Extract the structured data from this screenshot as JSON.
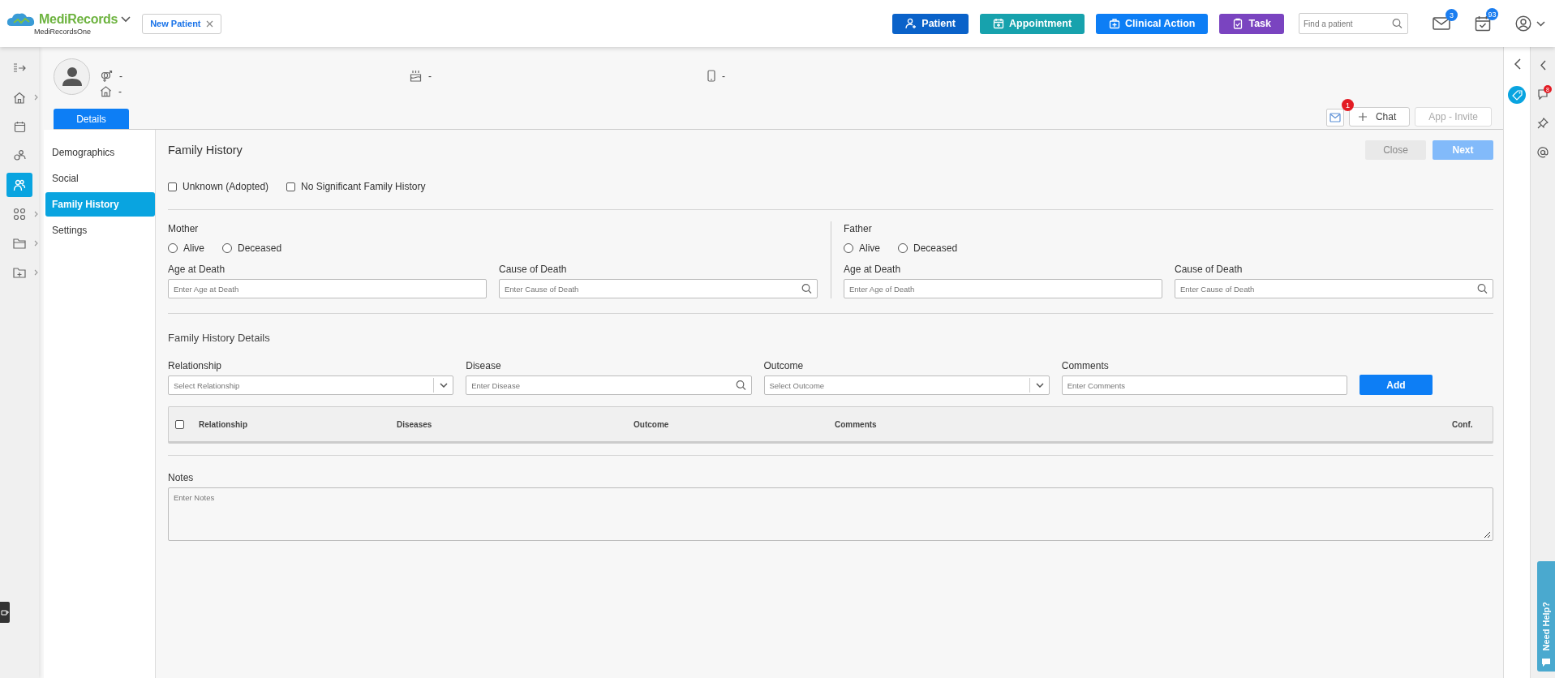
{
  "header": {
    "logo": "MediRecords",
    "logo_sub": "MediRecordsOne",
    "open_tab": {
      "label": "New Patient"
    },
    "actions": [
      {
        "label": "Patient",
        "kind": "patient",
        "color": "#0a62c9"
      },
      {
        "label": "Appointment",
        "kind": "appointment",
        "color": "#17a2ad"
      },
      {
        "label": "Clinical Action",
        "kind": "clinical",
        "color": "#0d7ef5"
      },
      {
        "label": "Task",
        "kind": "task",
        "color": "#7a44c0"
      }
    ],
    "search": {
      "placeholder": "Find a patient"
    },
    "mail_badge": "3",
    "tasks_badge": "93"
  },
  "rail": [
    {
      "kind": "expand",
      "selected": false,
      "submenu": false
    },
    {
      "kind": "home",
      "selected": false,
      "submenu": true
    },
    {
      "kind": "calendar",
      "selected": false,
      "submenu": false
    },
    {
      "kind": "people",
      "selected": false,
      "submenu": false
    },
    {
      "kind": "person",
      "selected": true,
      "submenu": false
    },
    {
      "kind": "apps",
      "selected": false,
      "submenu": true
    },
    {
      "kind": "folder",
      "selected": false,
      "submenu": true
    },
    {
      "kind": "folder-plus",
      "selected": false,
      "submenu": true
    }
  ],
  "patient": {
    "gender": "-",
    "address": "-",
    "birthday": "-",
    "phone": "-"
  },
  "tabs": [
    {
      "label": "Details",
      "selected": true
    }
  ],
  "toolbar": {
    "mail_badge": "1",
    "chat": "Chat",
    "invite": {
      "label": "App - Invite",
      "disabled": true
    }
  },
  "nav": [
    {
      "label": "Demographics",
      "selected": false
    },
    {
      "label": "Social",
      "selected": false
    },
    {
      "label": "Family History",
      "selected": true
    },
    {
      "label": "Settings",
      "selected": false
    }
  ],
  "form": {
    "title": "Family History",
    "buttons": [
      {
        "label": "Close",
        "kind": "secondary",
        "disabled": false
      },
      {
        "label": "Next",
        "kind": "primary",
        "disabled": true
      }
    ],
    "flags": [
      {
        "label": "Unknown (Adopted)",
        "checked": false
      },
      {
        "label": "No Significant Family History",
        "checked": false
      }
    ],
    "parents": [
      {
        "title": "Mother",
        "status": [
          {
            "label": "Alive",
            "selected": false
          },
          {
            "label": "Deceased",
            "selected": false
          }
        ],
        "age_label": "Age at Death",
        "age_placeholder": "Enter Age at Death",
        "cause_label": "Cause of Death",
        "cause_placeholder": "Enter Cause of Death"
      },
      {
        "title": "Father",
        "status": [
          {
            "label": "Alive",
            "selected": false
          },
          {
            "label": "Deceased",
            "selected": false
          }
        ],
        "age_label": "Age at Death",
        "age_placeholder": "Enter Age of Death",
        "cause_label": "Cause of Death",
        "cause_placeholder": "Enter Cause of Death"
      }
    ],
    "details_title": "Family History Details",
    "inputs": [
      {
        "label": "Relationship",
        "placeholder": "Select Relationship",
        "kind": "select"
      },
      {
        "label": "Disease",
        "placeholder": "Enter Disease",
        "kind": "search"
      },
      {
        "label": "Outcome",
        "placeholder": "Select Outcome",
        "kind": "select"
      },
      {
        "label": "Comments",
        "placeholder": "Enter Comments",
        "kind": "text"
      }
    ],
    "add_button": "Add",
    "table": {
      "all_checked": false,
      "columns": [
        "Relationship",
        "Diseases",
        "Outcome",
        "Comments",
        "Conf."
      ]
    },
    "notes_label": "Notes",
    "notes_placeholder": "Enter Notes"
  },
  "right_panel": {
    "chat_badge": "8",
    "help": "Need Help?"
  }
}
